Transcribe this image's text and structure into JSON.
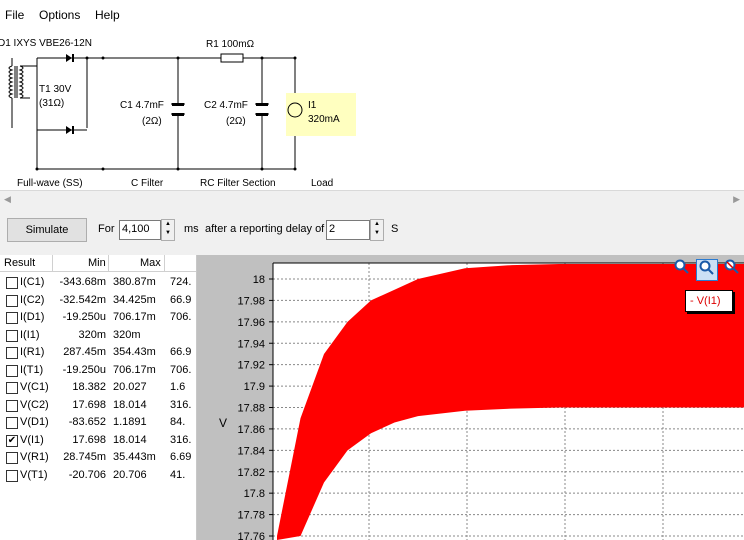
{
  "menu": [
    "File",
    "Options",
    "Help"
  ],
  "circuit": {
    "d1_label": "D1 IXYS  VBE26-12N",
    "r1_label": "R1 100mΩ",
    "t1_label": "T1 30V",
    "t1_res": "(31Ω)",
    "c1_label": "C1 4.7mF",
    "c1_res": "(2Ω)",
    "c2_label": "C2 4.7mF",
    "c2_res": "(2Ω)",
    "i1_label": "I1",
    "i1_value": "320mA",
    "sections": [
      "Full-wave (SS)",
      "C Filter",
      "RC Filter Section",
      "Load"
    ]
  },
  "sim": {
    "button": "Simulate",
    "for_label": "For",
    "duration": "4,100",
    "units": "ms",
    "delay_label": "after a reporting delay of",
    "delay": "2",
    "delay_units": "S"
  },
  "results": {
    "headers": [
      "Result",
      "Min",
      "Max"
    ],
    "rows": [
      {
        "name": "I(C1)",
        "min": "-343.68m",
        "max": "380.87m",
        "extra": "724.",
        "checked": false
      },
      {
        "name": "I(C2)",
        "min": "-32.542m",
        "max": "34.425m",
        "extra": "66.9",
        "checked": false
      },
      {
        "name": "I(D1)",
        "min": "-19.250u",
        "max": "706.17m",
        "extra": "706.",
        "checked": false
      },
      {
        "name": "I(I1)",
        "min": "320m",
        "max": "320m",
        "extra": "",
        "checked": false
      },
      {
        "name": "I(R1)",
        "min": "287.45m",
        "max": "354.43m",
        "extra": "66.9",
        "checked": false
      },
      {
        "name": "I(T1)",
        "min": "-19.250u",
        "max": "706.17m",
        "extra": "706.",
        "checked": false
      },
      {
        "name": "V(C1)",
        "min": "18.382",
        "max": "20.027",
        "extra": "1.6",
        "checked": false
      },
      {
        "name": "V(C2)",
        "min": "17.698",
        "max": "18.014",
        "extra": "316.",
        "checked": false
      },
      {
        "name": "V(D1)",
        "min": "-83.652",
        "max": "1.1891",
        "extra": "84.",
        "checked": false
      },
      {
        "name": "V(I1)",
        "min": "17.698",
        "max": "18.014",
        "extra": "316.",
        "checked": true
      },
      {
        "name": "V(R1)",
        "min": "28.745m",
        "max": "35.443m",
        "extra": "6.69",
        "checked": false
      },
      {
        "name": "V(T1)",
        "min": "-20.706",
        "max": "20.706",
        "extra": "41.",
        "checked": false
      }
    ]
  },
  "plot": {
    "legend": "- V(I1)",
    "ylabel": "V",
    "fill_color": "#ff0000"
  },
  "chart_data": {
    "type": "area",
    "title": "",
    "xlabel": "",
    "ylabel": "V",
    "ylim": [
      17.755,
      18.025
    ],
    "y_ticks": [
      17.76,
      17.78,
      17.8,
      17.82,
      17.84,
      17.86,
      17.88,
      17.9,
      17.92,
      17.94,
      17.96,
      17.98,
      18
    ],
    "grid": true,
    "series": [
      {
        "name": "V(I1)",
        "band": "upper",
        "x": [
          0,
          0.05,
          0.1,
          0.15,
          0.2,
          0.25,
          0.3,
          0.4,
          0.5,
          0.6,
          0.7,
          0.8,
          0.9,
          1.0
        ],
        "values": [
          17.76,
          17.87,
          17.93,
          17.96,
          17.98,
          17.99,
          18.0,
          18.01,
          18.013,
          18.014,
          18.014,
          18.014,
          18.014,
          18.014
        ]
      },
      {
        "name": "V(I1)",
        "band": "lower",
        "x": [
          0,
          0.05,
          0.1,
          0.15,
          0.2,
          0.25,
          0.3,
          0.4,
          0.5,
          0.6,
          0.7,
          0.8,
          0.9,
          1.0
        ],
        "values": [
          17.698,
          17.76,
          17.81,
          17.84,
          17.856,
          17.866,
          17.872,
          17.877,
          17.879,
          17.88,
          17.88,
          17.88,
          17.88,
          17.88
        ]
      }
    ]
  }
}
